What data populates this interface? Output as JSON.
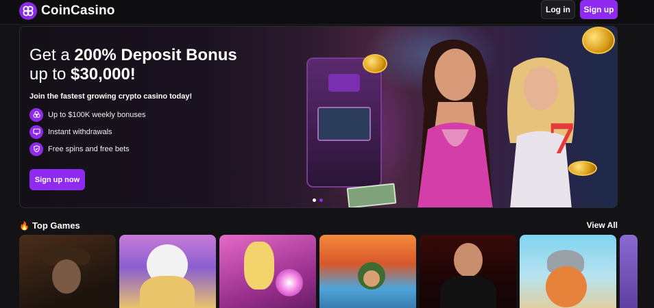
{
  "header": {
    "brand": "CoinCasino",
    "login_label": "Log in",
    "signup_label": "Sign up"
  },
  "hero": {
    "title_prefix": "Get a ",
    "title_bold_1": "200% Deposit Bonus",
    "title_line2_prefix": "up to ",
    "title_bold_2": "$30,000!",
    "subtitle": "Join the fastest growing crypto casino today!",
    "features": [
      {
        "icon": "coins-stack-icon",
        "text": "Up to $100K weekly bonuses"
      },
      {
        "icon": "chat-bubble-icon",
        "text": "Instant withdrawals"
      },
      {
        "icon": "shield-check-icon",
        "text": "Free spins and free bets"
      }
    ],
    "cta_label": "Sign up now",
    "carousel_slides": 2,
    "active_slide": 1
  },
  "top_games": {
    "title": "Top Games",
    "view_all_label": "View All",
    "games_count": 7
  },
  "colors": {
    "accent": "#8f2bf0",
    "background": "#131316",
    "topbar": "#0e0e11"
  }
}
